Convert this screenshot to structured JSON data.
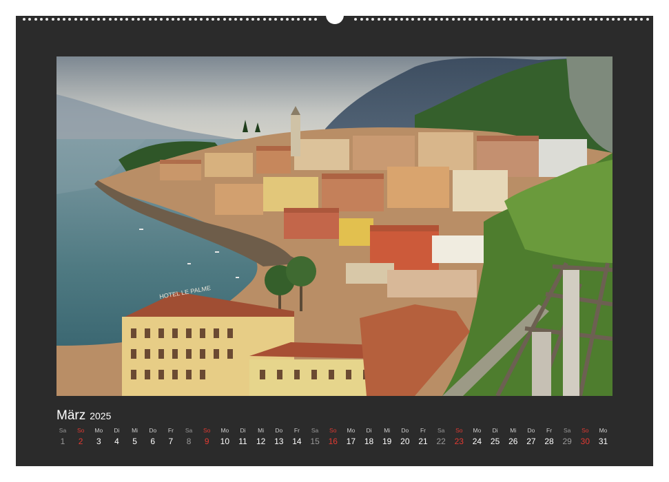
{
  "calendar": {
    "month": "März",
    "year": "2025"
  },
  "photo": {
    "hotel_sign": "HOTEL LE PALME"
  },
  "days": [
    {
      "weekday": "Sa",
      "day": "1",
      "type": "sat"
    },
    {
      "weekday": "So",
      "day": "2",
      "type": "sun"
    },
    {
      "weekday": "Mo",
      "day": "3",
      "type": "week"
    },
    {
      "weekday": "Di",
      "day": "4",
      "type": "week"
    },
    {
      "weekday": "Mi",
      "day": "5",
      "type": "week"
    },
    {
      "weekday": "Do",
      "day": "6",
      "type": "week"
    },
    {
      "weekday": "Fr",
      "day": "7",
      "type": "week"
    },
    {
      "weekday": "Sa",
      "day": "8",
      "type": "sat"
    },
    {
      "weekday": "So",
      "day": "9",
      "type": "sun"
    },
    {
      "weekday": "Mo",
      "day": "10",
      "type": "week"
    },
    {
      "weekday": "Di",
      "day": "11",
      "type": "week"
    },
    {
      "weekday": "Mi",
      "day": "12",
      "type": "week"
    },
    {
      "weekday": "Do",
      "day": "13",
      "type": "week"
    },
    {
      "weekday": "Fr",
      "day": "14",
      "type": "week"
    },
    {
      "weekday": "Sa",
      "day": "15",
      "type": "sat"
    },
    {
      "weekday": "So",
      "day": "16",
      "type": "sun"
    },
    {
      "weekday": "Mo",
      "day": "17",
      "type": "week"
    },
    {
      "weekday": "Di",
      "day": "18",
      "type": "week"
    },
    {
      "weekday": "Mi",
      "day": "19",
      "type": "week"
    },
    {
      "weekday": "Do",
      "day": "20",
      "type": "week"
    },
    {
      "weekday": "Fr",
      "day": "21",
      "type": "week"
    },
    {
      "weekday": "Sa",
      "day": "22",
      "type": "sat"
    },
    {
      "weekday": "So",
      "day": "23",
      "type": "sun"
    },
    {
      "weekday": "Mo",
      "day": "24",
      "type": "week"
    },
    {
      "weekday": "Di",
      "day": "25",
      "type": "week"
    },
    {
      "weekday": "Mi",
      "day": "26",
      "type": "week"
    },
    {
      "weekday": "Do",
      "day": "27",
      "type": "week"
    },
    {
      "weekday": "Fr",
      "day": "28",
      "type": "week"
    },
    {
      "weekday": "Sa",
      "day": "29",
      "type": "sat"
    },
    {
      "weekday": "So",
      "day": "30",
      "type": "sun"
    },
    {
      "weekday": "Mo",
      "day": "31",
      "type": "week"
    }
  ],
  "colors": {
    "page_background": "#2b2b2b",
    "sunday": "#e23a32",
    "saturday": "#9a9a9a",
    "text": "#ffffff"
  }
}
